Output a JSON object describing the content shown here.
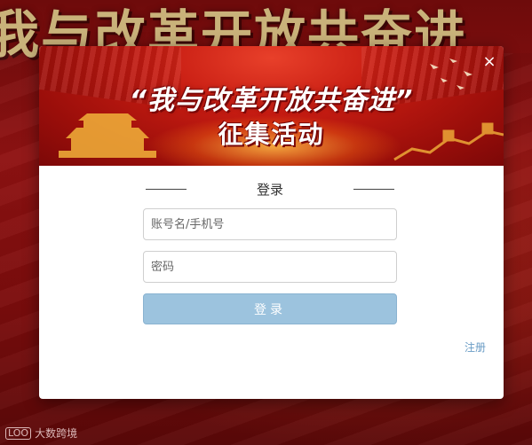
{
  "background": {
    "headline": "我与改革开放共奋进"
  },
  "modal": {
    "banner": {
      "line1": "“我与改革开放共奋进”",
      "line2": "征集活动"
    },
    "close_label": "×",
    "title": "登录",
    "account_input": {
      "placeholder": "账号名/手机号",
      "value": ""
    },
    "password_input": {
      "placeholder": "密码",
      "value": ""
    },
    "login_button": "登录",
    "register_link": "注册"
  },
  "watermark": {
    "logo": "LOO",
    "text": "大数跨境"
  },
  "colors": {
    "accent": "#9cc3de",
    "link": "#6a9cc5",
    "background_red": "#8f1212",
    "banner_red": "#c71c12"
  }
}
